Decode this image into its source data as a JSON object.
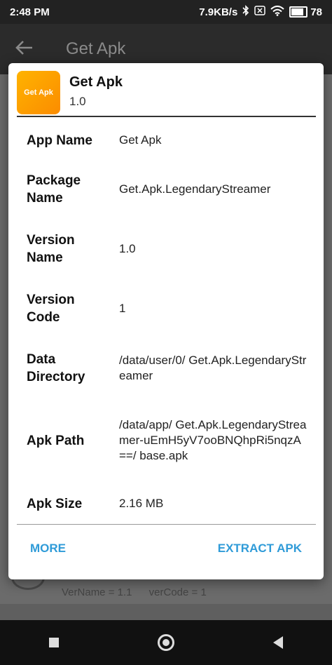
{
  "status_bar": {
    "time": "2:48 PM",
    "network_speed": "7.9KB/s",
    "battery_percent": "78",
    "battery_level": 0.78,
    "icons": [
      "bluetooth-icon",
      "sim-x-icon",
      "wifi-icon",
      "battery-icon"
    ]
  },
  "app_bar": {
    "title": "Get Apk",
    "back_icon": "back-arrow-icon"
  },
  "background_row": {
    "ver_name": "VerName = 1.1",
    "ver_code": "verCode = 1"
  },
  "dialog": {
    "icon_text": "Get Apk",
    "title": "Get Apk",
    "version": "1.0",
    "rows": [
      {
        "label_line1": "App Name",
        "label_line2": "",
        "value": "Get Apk"
      },
      {
        "label_line1": "Package",
        "label_line2": "Name",
        "value": "Get.Apk.LegendaryStreamer"
      },
      {
        "label_line1": "Version",
        "label_line2": "Name",
        "value": "1.0"
      },
      {
        "label_line1": "Version",
        "label_line2": "Code",
        "value": "1"
      },
      {
        "label_line1": "Data",
        "label_line2": "Directory",
        "value": "/data/user/0/ Get.Apk.LegendaryStreamer"
      },
      {
        "label_line1": "Apk Path",
        "label_line2": "",
        "value": "/data/app/ Get.Apk.LegendaryStreamer-uEmH5yV7ooBNQhpRi5nqzA==/ base.apk"
      },
      {
        "label_line1": "Apk Size",
        "label_line2": "",
        "value": "2.16 MB"
      }
    ],
    "more_label": "MORE",
    "extract_label": "EXTRACT APK"
  },
  "colors": {
    "accent": "#2f9bd8",
    "icon_orange": "#fb8c00"
  }
}
